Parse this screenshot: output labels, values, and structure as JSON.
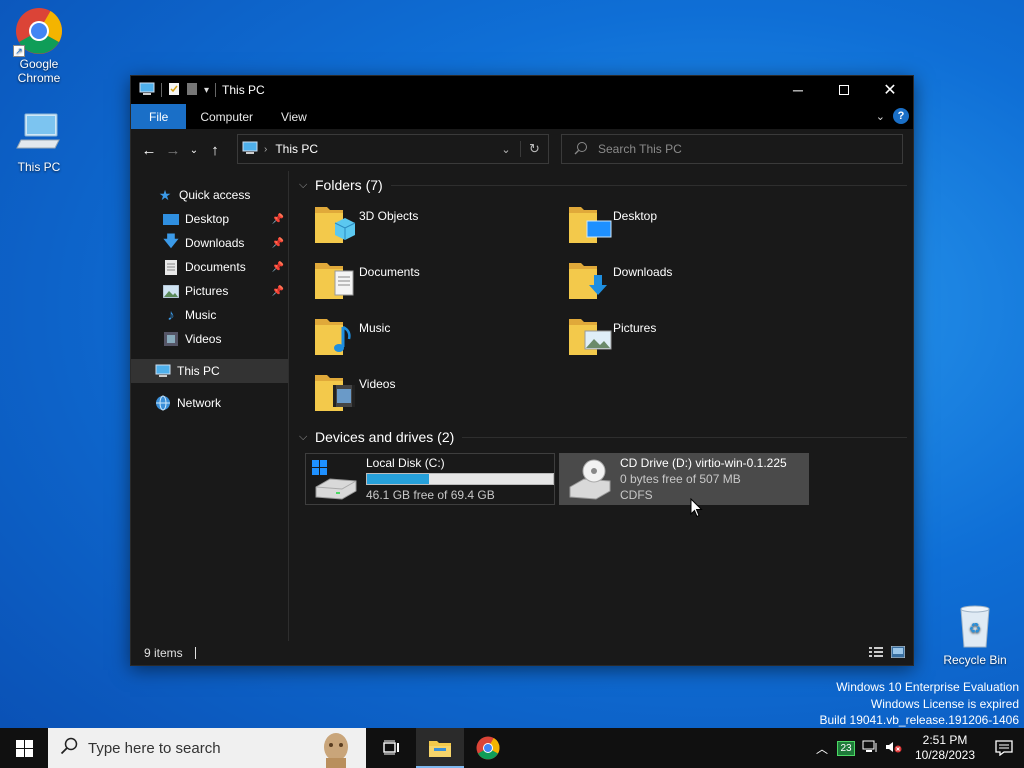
{
  "desktop": {
    "icons": [
      {
        "label": "Google Chrome"
      },
      {
        "label": "This PC"
      },
      {
        "label": "Recycle Bin"
      }
    ]
  },
  "window": {
    "title": "This PC",
    "ribbon_tabs": [
      "File",
      "Computer",
      "View"
    ],
    "help_label": "?",
    "address_crumb": "This PC",
    "search_placeholder": "Search This PC"
  },
  "nav_pane": {
    "quick_access": "Quick access",
    "quick_items": [
      {
        "label": "Desktop",
        "icon": "desktop-folder-icon",
        "pinned": true
      },
      {
        "label": "Downloads",
        "icon": "download-arrow-icon",
        "pinned": true
      },
      {
        "label": "Documents",
        "icon": "document-icon",
        "pinned": true
      },
      {
        "label": "Pictures",
        "icon": "picture-icon",
        "pinned": true
      },
      {
        "label": "Music",
        "icon": "music-note-icon",
        "pinned": false
      },
      {
        "label": "Videos",
        "icon": "video-icon",
        "pinned": false
      }
    ],
    "this_pc": "This PC",
    "network": "Network"
  },
  "content": {
    "folders_header": "Folders (7)",
    "folders": [
      {
        "name": "3D Objects",
        "icon": "3d-objects-folder-icon"
      },
      {
        "name": "Desktop",
        "icon": "desktop-folder-icon"
      },
      {
        "name": "Documents",
        "icon": "documents-folder-icon"
      },
      {
        "name": "Downloads",
        "icon": "downloads-folder-icon"
      },
      {
        "name": "Music",
        "icon": "music-folder-icon"
      },
      {
        "name": "Pictures",
        "icon": "pictures-folder-icon"
      },
      {
        "name": "Videos",
        "icon": "videos-folder-icon"
      }
    ],
    "devices_header": "Devices and drives (2)",
    "drives": [
      {
        "name": "Local Disk (C:)",
        "free_text": "46.1 GB free of 69.4 GB",
        "used_fraction": 0.336
      },
      {
        "name": "CD Drive (D:) virtio-win-0.1.225",
        "free_text": "0 bytes free of 507 MB",
        "fs": "CDFS"
      }
    ]
  },
  "status_bar": {
    "items": "9 items"
  },
  "watermark": {
    "line1": "Windows 10 Enterprise Evaluation",
    "line2": "Windows License is expired",
    "line3": "Build 19041.vb_release.191206-1406"
  },
  "taskbar": {
    "search_placeholder": "Type here to search",
    "tray_badge": "23",
    "time": "2:51 PM",
    "date": "10/28/2023"
  },
  "colors": {
    "accent": "#1a6fc7",
    "drive_bar": "#26a0da",
    "folder_yellow": "#f3c94b"
  }
}
